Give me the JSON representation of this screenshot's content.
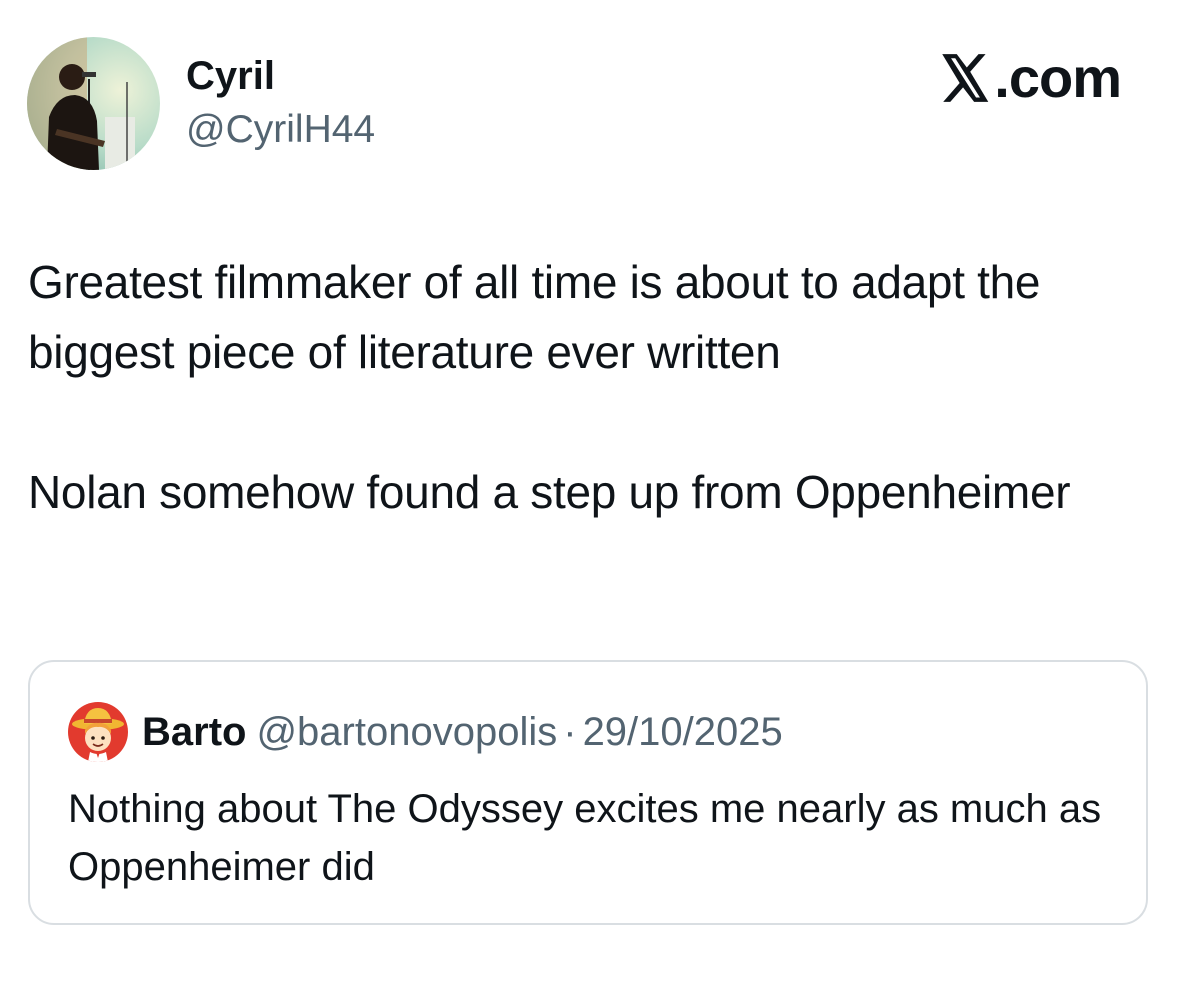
{
  "tweet": {
    "author": {
      "name": "Cyril",
      "handle": "@CyrilH44",
      "avatar_icon": "avatar-photo"
    },
    "brand": {
      "logo_icon": "x-logo-icon",
      "text": ".com"
    },
    "paragraphs": [
      "Greatest filmmaker of all time is about to adapt the biggest piece of literature ever written",
      "Nolan somehow found a step up from Oppenheimer"
    ]
  },
  "quote": {
    "author": {
      "name": "Barto",
      "handle": "@bartonovopolis",
      "avatar_icon": "cartoon-cowboy-avatar"
    },
    "separator": "·",
    "date": "29/10/2025",
    "text": "Nothing about The Odyssey excites me nearly as much as Oppenheimer did"
  },
  "colors": {
    "text": "#0f1419",
    "secondary": "#536471",
    "border": "#d9dee2"
  }
}
